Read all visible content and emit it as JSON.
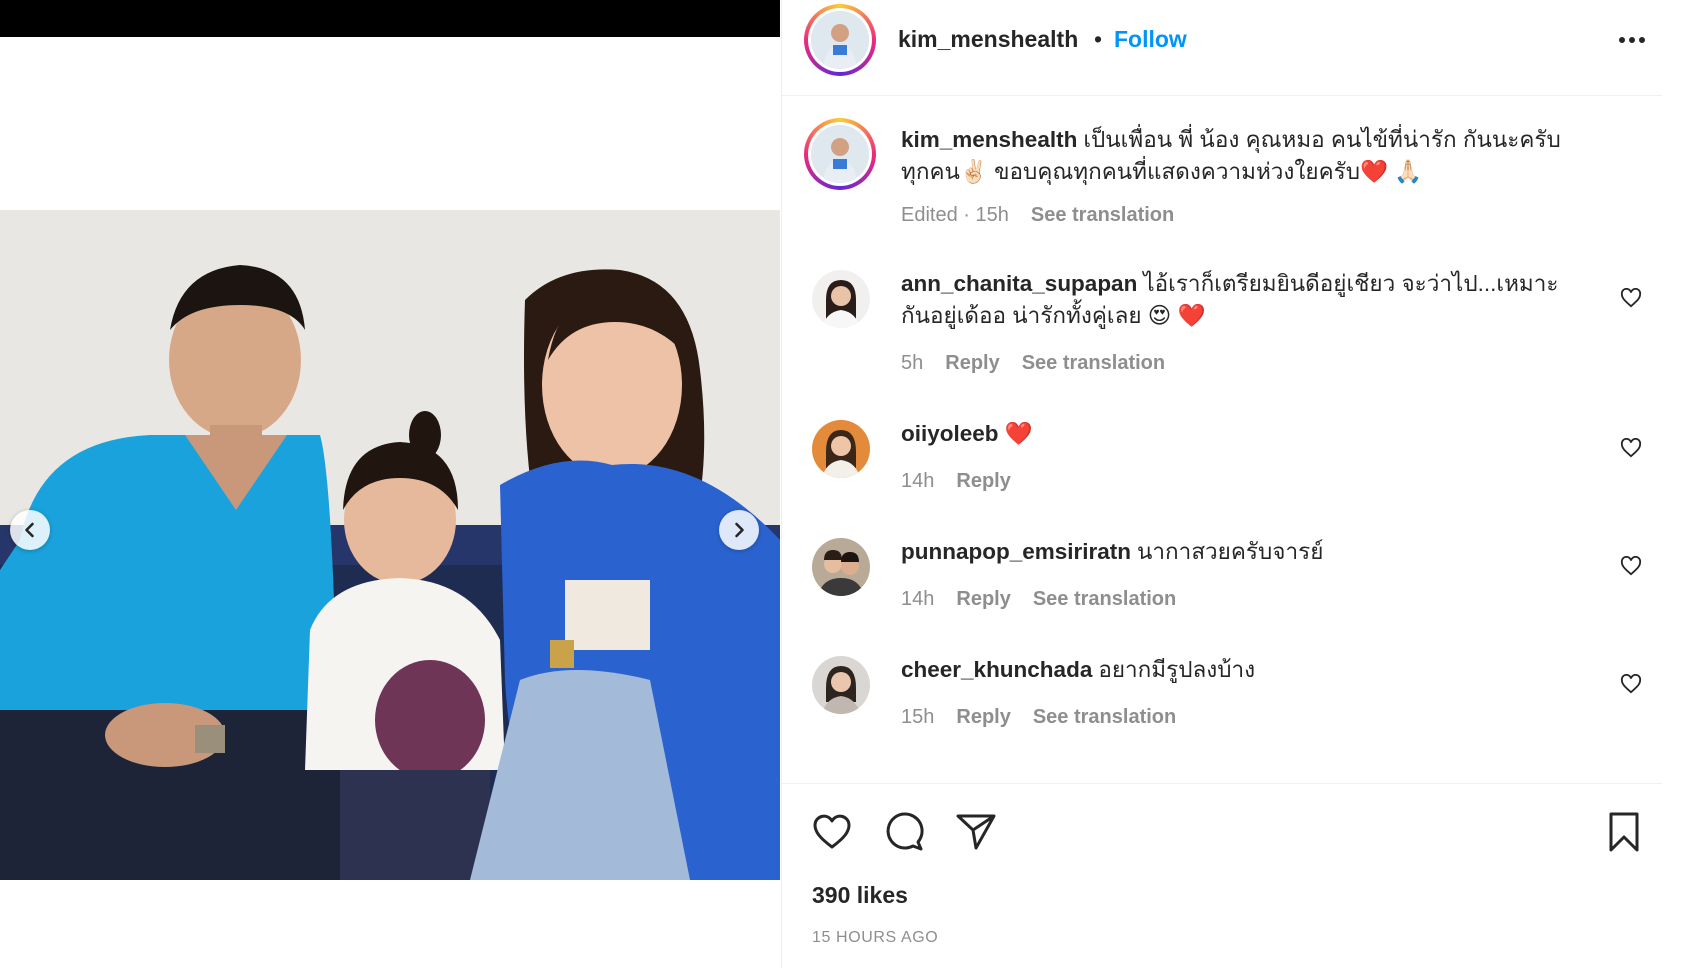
{
  "post": {
    "author": "kim_menshealth",
    "separator": "•",
    "follow_label": "Follow",
    "caption_text": "เป็นเพื่อน พี่ น้อง คุณหมอ คนไข้ที่น่ารัก กันนะครับทุกคน✌🏻 ขอบคุณทุกคนที่แสดงความห่วงใยครับ❤️ 🙏🏻",
    "caption_meta": "Edited · 15h",
    "caption_translate": "See translation",
    "likes": "390 likes",
    "time_ago": "15 HOURS AGO"
  },
  "comments": [
    {
      "user": "ann_chanita_supapan",
      "text": "ไอ้เราก็เตรียมยินดีอยู่เชียว จะว่าไป...เหมาะกันอยู่เด้ออ น่ารักทั้งคู่เลย 😍 ❤️",
      "time": "5h",
      "reply": "Reply",
      "translate": "See translation"
    },
    {
      "user": "oiiyoleeb",
      "text": "❤️",
      "time": "14h",
      "reply": "Reply",
      "translate": ""
    },
    {
      "user": "punnapop_emsiriratn",
      "text": "นากาสวยครับจารย์",
      "time": "14h",
      "reply": "Reply",
      "translate": "See translation"
    },
    {
      "user": "cheer_khunchada",
      "text": "อยากมีรูปลงบ้าง",
      "time": "15h",
      "reply": "Reply",
      "translate": "See translation"
    }
  ],
  "icons": {
    "more": "more-options-icon",
    "like": "heart-icon",
    "comment": "comment-icon",
    "share": "share-icon",
    "save": "bookmark-icon",
    "prev": "chevron-left-icon",
    "next": "chevron-right-icon"
  },
  "colors": {
    "accent": "#0095f6",
    "text": "#262626",
    "muted": "#8e8e8e",
    "divider": "#efefef"
  }
}
